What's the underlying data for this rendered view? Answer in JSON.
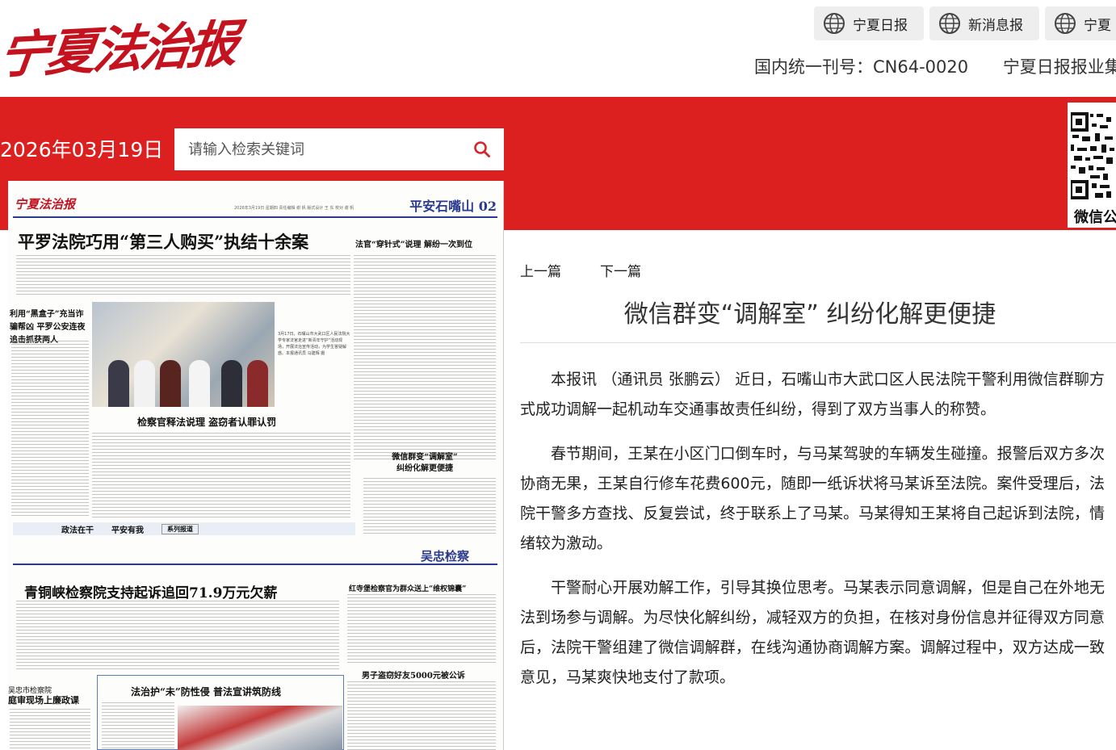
{
  "header": {
    "logo_text": "宁夏法治报",
    "paper_links": [
      {
        "label": "宁夏日报",
        "icon": "globe-icon"
      },
      {
        "label": "新消息报",
        "icon": "globe-icon"
      },
      {
        "label": "宁夏",
        "icon": "globe-icon"
      }
    ],
    "issn": "国内统一刊号：CN64-0020",
    "publisher": "宁夏日报报业集"
  },
  "toolbar": {
    "date": "2026年03月19日",
    "search_placeholder": "请输入检索关键词",
    "search_icon": "search-icon"
  },
  "qr": {
    "label": "微信公",
    "icon": "qr-code-icon"
  },
  "newspaper_page": {
    "masthead": "宁夏法治报",
    "dateline": "2026年3月19日  星期四  责任编辑 谢 帆  版式设计 王 东  校对 谢 帆",
    "section_top": "平安石嘴山 02",
    "headline_main": "平罗法院巧用“第三人购买”执结十余案",
    "headline_right": "法官“穿针式”说理 解纷一次到位",
    "headline_side": "利用“黑盒子”充当诈骗帮凶 平罗公安连夜追击抓获两人",
    "photo_caption": "3月17日，石嘴山市大武口区人民法院大学专家法官走进“新青年守护”活动现场，开展法治宣传活动，为学生答疑解惑。本报通讯员 马建辉 摄",
    "headline_mid": "检察官释法说理 盗窃者认罪认罚",
    "box_title_1": "微信群变“调解室”",
    "box_title_2": "纠纷化解更便捷",
    "footer_items": [
      "政法在干",
      "平安有我",
      "系列报道"
    ],
    "section_bottom": "吴忠检察",
    "headline_bottom": "青铜峡检察院支持起诉追回71.9万元欠薪",
    "headline_bottom_right": "红寺堡检察官为群众送上“维权锦囊”",
    "headline_box": "法治护“未”防性侵 普法宣讲筑防线",
    "headline_left_bottom_1": "吴忠市检察院",
    "headline_left_bottom_2": "庭审现场上廉政课",
    "headline_right_bottom": "男子盗窃好友5000元被公诉"
  },
  "article": {
    "prev_label": "上一篇",
    "next_label": "下一篇",
    "title": "微信群变“调解室” 纠纷化解更便捷",
    "paragraphs": [
      "本报讯 （通讯员 张鹏云） 近日，石嘴山市大武口区人民法院干警利用微信群聊方式成功调解一起机动车交通事故责任纠纷，得到了双方当事人的称赞。",
      "春节期间，王某在小区门口倒车时，与马某驾驶的车辆发生碰撞。报警后双方多次协商无果，王某自行修车花费600元，随即一纸诉状将马某诉至法院。案件受理后，法院干警多方查找、反复尝试，终于联系上了马某。马某得知王某将自己起诉到法院，情绪较为激动。",
      "干警耐心开展劝解工作，引导其换位思考。马某表示同意调解，但是自己在外地无法到场参与调解。为尽快化解纠纷，减轻双方的负担，在核对身份信息并征得双方同意后，法院干警组建了微信调解群，在线沟通协商调解方案。调解过程中，双方达成一致意见，马某爽快地支付了款项。"
    ]
  },
  "colors": {
    "brand_red": "#dc1f1f",
    "logo_red": "#c4121f",
    "section_blue": "#2a3b8f"
  }
}
